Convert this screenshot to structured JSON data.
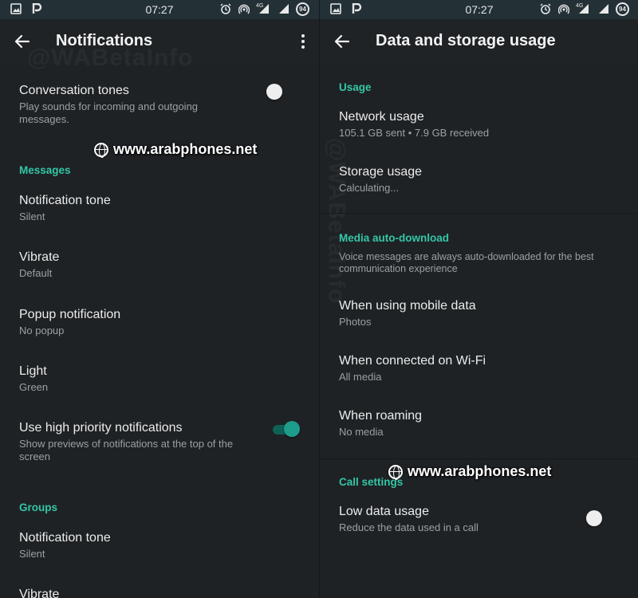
{
  "status_bar": {
    "time": "07:27",
    "signal_label": "4G",
    "battery": "94"
  },
  "left": {
    "title": "Notifications",
    "conversation_tones": {
      "title": "Conversation tones",
      "subtitle": "Play sounds for incoming and outgoing messages.",
      "enabled": false
    },
    "messages_header": "Messages",
    "messages": [
      {
        "title": "Notification tone",
        "value": "Silent"
      },
      {
        "title": "Vibrate",
        "value": "Default"
      },
      {
        "title": "Popup notification",
        "value": "No popup"
      },
      {
        "title": "Light",
        "value": "Green"
      }
    ],
    "high_priority": {
      "title": "Use high priority notifications",
      "subtitle": "Show previews of notifications at the top of the screen",
      "enabled": true
    },
    "groups_header": "Groups",
    "groups": [
      {
        "title": "Notification tone",
        "value": "Silent"
      },
      {
        "title": "Vibrate",
        "value": ""
      }
    ]
  },
  "right": {
    "title": "Data and storage usage",
    "usage_header": "Usage",
    "network_usage": {
      "title": "Network usage",
      "value": "105.1 GB sent • 7.9 GB received"
    },
    "storage_usage": {
      "title": "Storage usage",
      "value": "Calculating..."
    },
    "media_header": "Media auto-download",
    "media_note": "Voice messages are always auto-downloaded for the best communication experience",
    "media": [
      {
        "title": "When using mobile data",
        "value": "Photos"
      },
      {
        "title": "When connected on Wi-Fi",
        "value": "All media"
      },
      {
        "title": "When roaming",
        "value": "No media"
      }
    ],
    "call_header": "Call settings",
    "low_data": {
      "title": "Low data usage",
      "subtitle": "Reduce the data used in a call",
      "enabled": false
    }
  },
  "watermarks": {
    "site": "www.arabphones.net",
    "ghost": "@WABetaInfo"
  },
  "colors": {
    "accent": "#34c6a6",
    "background": "#1e2225",
    "status_bar": "#233137",
    "switch_on": "#1e9c8c"
  }
}
